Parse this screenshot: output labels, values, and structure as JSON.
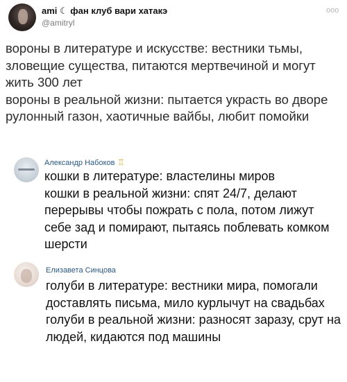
{
  "tweet": {
    "display_name": "ami ☾ фан клуб вари хатакэ",
    "handle": "@amitryl",
    "more_icon": "ooo",
    "lines": [
      "вороны в литературе и искусстве: вестники тьмы, зловещие существа, питаются мертвечиной и могут жить 300 лет",
      "вороны в реальной жизни: пытается украсть во дворе рулонный газон, хаотичные вайбы, любит помойки"
    ]
  },
  "comments": [
    {
      "author": "Александр Набоков",
      "badge": "♖",
      "lines": [
        "кошки в литературе: властелины миров",
        "кошки в реальной жизни: спят 24/7, делают перерывы чтобы пожрать с пола, потом лижут себе зад и помирают, пытаясь поблевать комком шерсти"
      ]
    },
    {
      "author": "Елизавета Синцова",
      "lines": [
        "голуби в литературе: вестники мира, помогали доставлять письма, мило курлычут на свадьбах",
        "голуби в реальной жизни: разносят заразу, срут на людей, кидаются под машины"
      ]
    }
  ]
}
